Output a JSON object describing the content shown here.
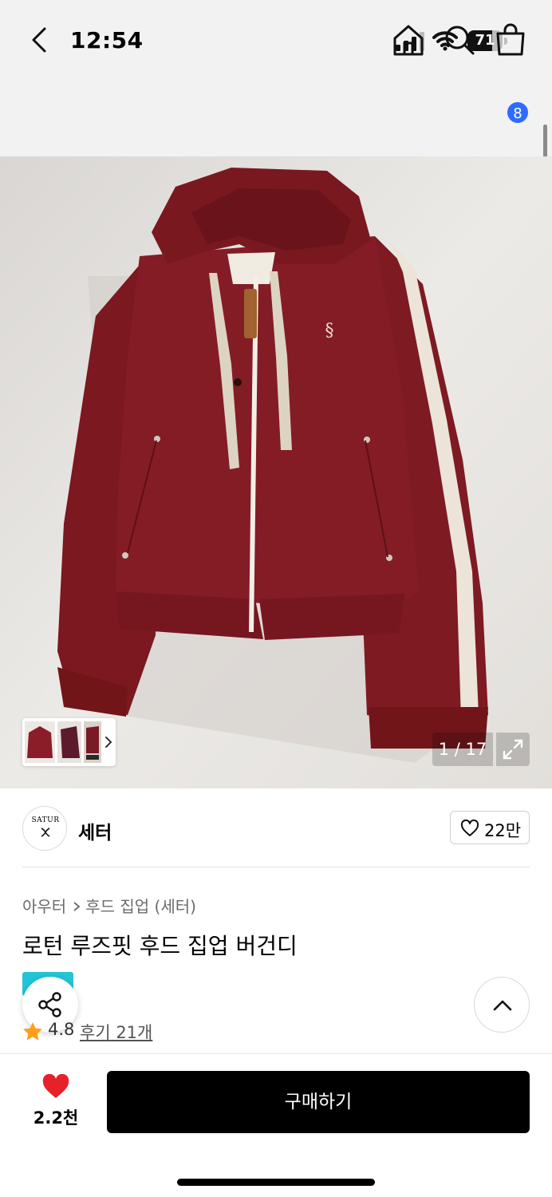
{
  "status_bar": {
    "time": "12:54",
    "battery_level": "71",
    "battery_fraction": 0.71,
    "icons": [
      "cellular-signal-icon",
      "wifi-icon",
      "battery-icon"
    ]
  },
  "header": {
    "icons": [
      "back-chevron-icon",
      "home-icon",
      "search-icon",
      "shopping-bag-icon"
    ],
    "cart_count": "8",
    "badge_color": "#2f6bff"
  },
  "gallery": {
    "counter": "1 / 17",
    "image_subject": "burgundy-hooded-zip-up-jacket",
    "thumbnail_icons": [
      "thumbnail-front-icon",
      "thumbnail-side-icon",
      "thumbnail-detail-icon",
      "chevron-right-icon"
    ]
  },
  "brand": {
    "logo_text": "SATUR",
    "name": "세터",
    "like_count": "22만"
  },
  "product": {
    "breadcrumb": [
      "아우터",
      "후드 집업 (세터)"
    ],
    "title": "로턴 루즈핏 후드 집업 버건디",
    "rating": "4.8",
    "review_label": "후기 21개",
    "tag_color": "#23c4d8",
    "garment_color": "#7e1a22"
  },
  "bottom_bar": {
    "wish_count": "2.2천",
    "buy_label": "구매하기",
    "heart_color": "#e8202a"
  }
}
